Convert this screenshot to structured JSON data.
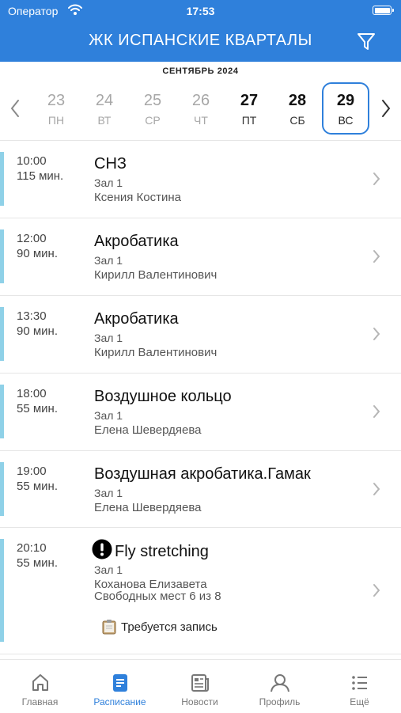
{
  "status_bar": {
    "carrier": "Оператор",
    "time": "17:53"
  },
  "header": {
    "title": "ЖК ИСПАНСКИЕ КВАРТАЛЫ"
  },
  "calendar": {
    "month": "СЕНТЯБРЬ 2024",
    "days": [
      {
        "num": "23",
        "weekday": "ПН"
      },
      {
        "num": "24",
        "weekday": "ВТ"
      },
      {
        "num": "25",
        "weekday": "СР"
      },
      {
        "num": "26",
        "weekday": "ЧТ"
      },
      {
        "num": "27",
        "weekday": "ПТ"
      },
      {
        "num": "28",
        "weekday": "СБ"
      },
      {
        "num": "29",
        "weekday": "ВС"
      }
    ]
  },
  "lessons": [
    {
      "time": "10:00",
      "duration": "115 мин.",
      "name": "СНЗ",
      "hall": "Зал 1",
      "coach": "Ксения Костина"
    },
    {
      "time": "12:00",
      "duration": "90 мин.",
      "name": "Акробатика",
      "hall": "Зал 1",
      "coach": "Кирилл Валентинович"
    },
    {
      "time": "13:30",
      "duration": "90 мин.",
      "name": "Акробатика",
      "hall": "Зал 1",
      "coach": "Кирилл Валентинович"
    },
    {
      "time": "18:00",
      "duration": "55 мин.",
      "name": "Воздушное кольцо",
      "hall": "Зал 1",
      "coach": "Елена Шевердяева"
    },
    {
      "time": "19:00",
      "duration": "55 мин.",
      "name": "Воздушная акробатика.Гамак",
      "hall": "Зал 1",
      "coach": "Елена Шевердяева"
    },
    {
      "time": "20:10",
      "duration": "55 мин.",
      "name": "Fly stretching",
      "hall": "Зал 1",
      "coach": "Коханова Елизавета",
      "seats": "Свободных мест 6 из 8",
      "note": "Требуется запись"
    }
  ],
  "tabs": [
    {
      "label": "Главная",
      "icon": "home-icon"
    },
    {
      "label": "Расписание",
      "icon": "schedule-icon"
    },
    {
      "label": "Новости",
      "icon": "news-icon"
    },
    {
      "label": "Профиль",
      "icon": "profile-icon"
    },
    {
      "label": "Ещё",
      "icon": "more-icon"
    }
  ],
  "colors": {
    "accent": "#2f80db",
    "lesson_bar": "#8fd1e8",
    "inactive": "#777777"
  }
}
